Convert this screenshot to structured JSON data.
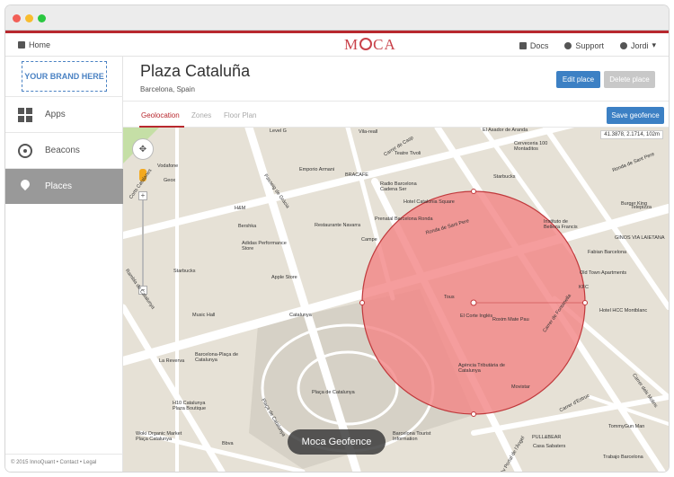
{
  "topnav": {
    "home": "Home",
    "logo": "MOCA",
    "docs": "Docs",
    "support": "Support",
    "user": "Jordi"
  },
  "sidebar": {
    "brand": "YOUR BRAND HERE",
    "items": [
      {
        "label": "Apps"
      },
      {
        "label": "Beacons"
      },
      {
        "label": "Places"
      }
    ],
    "footer": "© 2015 InnoQuant • Contact • Legal"
  },
  "place": {
    "title": "Plaza Cataluña",
    "subtitle": "Barcelona, Spain"
  },
  "buttons": {
    "edit": "Edit place",
    "delete": "Delete place",
    "save": "Save geofence"
  },
  "tabs": [
    {
      "label": "Geolocation"
    },
    {
      "label": "Zones"
    },
    {
      "label": "Floor Plan"
    }
  ],
  "map": {
    "coords": "41.3878, 2.1714, 102m",
    "geofence_label": "Moca Geofence",
    "labels": [
      "Vila-reall",
      "El Asador de Aranda",
      "Teatre Tivoli",
      "Emporio Armani",
      "BRACAFE",
      "Radio Barcelona Cadena Ser",
      "Hotel Catalonia Square",
      "Starbucks",
      "Ronda de Sant Pere",
      "Prenatal Barcelona Ronda",
      "Instituto de Belleza Francis",
      "H&M",
      "Bershka",
      "Restaurante Navarra",
      "Campe",
      "Adidas Performance Store",
      "Apple Store",
      "Tous",
      "El Corte Inglés",
      "Roxim Mate Pau",
      "Music Hall",
      "Catalunya",
      "Starbucks",
      "Barcelona-Plaça de Catalunya",
      "La Reverva",
      "Plaça de Catalunya",
      "H10 Catalunya Plaza Boutique",
      "Agència Tributària de Catalunya",
      "Movistar",
      "Woki Organic Market Plaça Catalunya",
      "Bbva",
      "Barcelona Tourist Information",
      "PULL&BEAR",
      "Casa Sabaters",
      "Trabajo Barcelona",
      "TommyGun Man",
      "Hotel HCC Montblanc",
      "Old Town Apartments",
      "KFC",
      "Burger King",
      "GINOS VIA LAIETANA",
      "Telepizza",
      "Ronda de Sant Pere",
      "Cerveceria 100 Montaditos",
      "Vodafone",
      "Geox",
      "Passeig de Gràcia",
      "Level G",
      "Carrer de Casp",
      "Carrer de Fontanella",
      "Carrer d'Estruc",
      "Carrer dels Molins",
      "Rambla de Catalunya",
      "Plaça de Catalunya",
      "Av Portal de l'Àngel",
      "Corts Catalanes",
      "Fabian Barcelona"
    ],
    "colors": {
      "geofence_fill": "#f28585",
      "geofence_stroke": "#c0393c",
      "road": "#ffffff",
      "block": "#e6e1d6",
      "square": "#d6d1c6",
      "park": "#c5dfa6"
    }
  }
}
